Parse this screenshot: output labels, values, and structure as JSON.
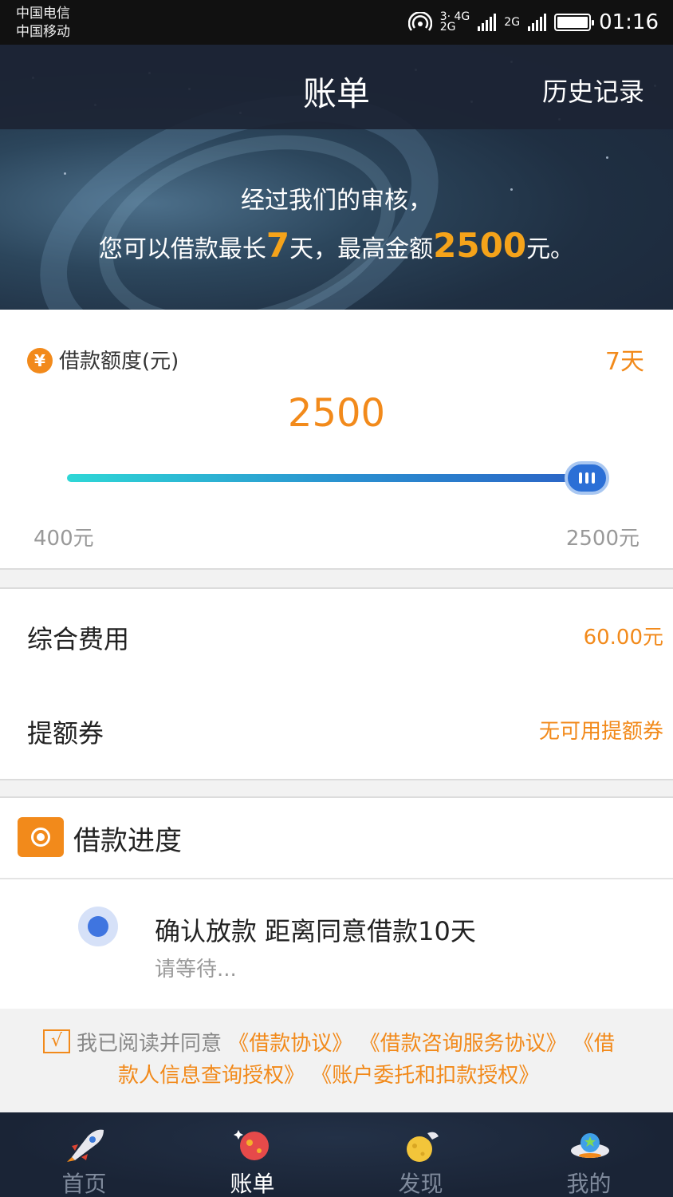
{
  "status_bar": {
    "carrier1": "中国电信",
    "carrier2": "中国移动",
    "net1": "3· 4G",
    "net1b": "2G",
    "net2": "2G",
    "time": "01:16"
  },
  "header": {
    "title": "账单",
    "history_label": "历史记录"
  },
  "hero": {
    "line1": "经过我们的审核，",
    "line2_pre": "您可以借款最长",
    "max_days": "7",
    "line2_mid": "天，最高金额",
    "max_amount": "2500",
    "line2_post": "元。"
  },
  "loan": {
    "label": "借款额度(元)",
    "days": "7天",
    "amount": "2500",
    "min_label": "400元",
    "max_label": "2500元",
    "slider_fraction": 1.0
  },
  "fee": {
    "label": "综合费用",
    "value": "60.00元"
  },
  "coupon": {
    "label": "提额券",
    "value": "无可用提额券"
  },
  "progress": {
    "title": "借款进度",
    "step_title": "确认放款 距离同意借款10天",
    "step_sub": "请等待..."
  },
  "agreement": {
    "checkbox_mark": "√",
    "prefix": "我已阅读并同意",
    "link1": "《借款协议》",
    "link2": "《借款咨询服务协议》",
    "link3a": "《借",
    "link3b": "款人信息查询授权》",
    "link4": "《账户委托和扣款授权》"
  },
  "tabs": [
    {
      "label": "首页",
      "icon": "rocket-icon"
    },
    {
      "label": "账单",
      "icon": "planet-icon"
    },
    {
      "label": "发现",
      "icon": "moon-icon"
    },
    {
      "label": "我的",
      "icon": "ufo-icon"
    }
  ],
  "colors": {
    "accent": "#f28a1b",
    "slider_start": "#2ed7d6",
    "slider_end": "#2b63c6"
  }
}
